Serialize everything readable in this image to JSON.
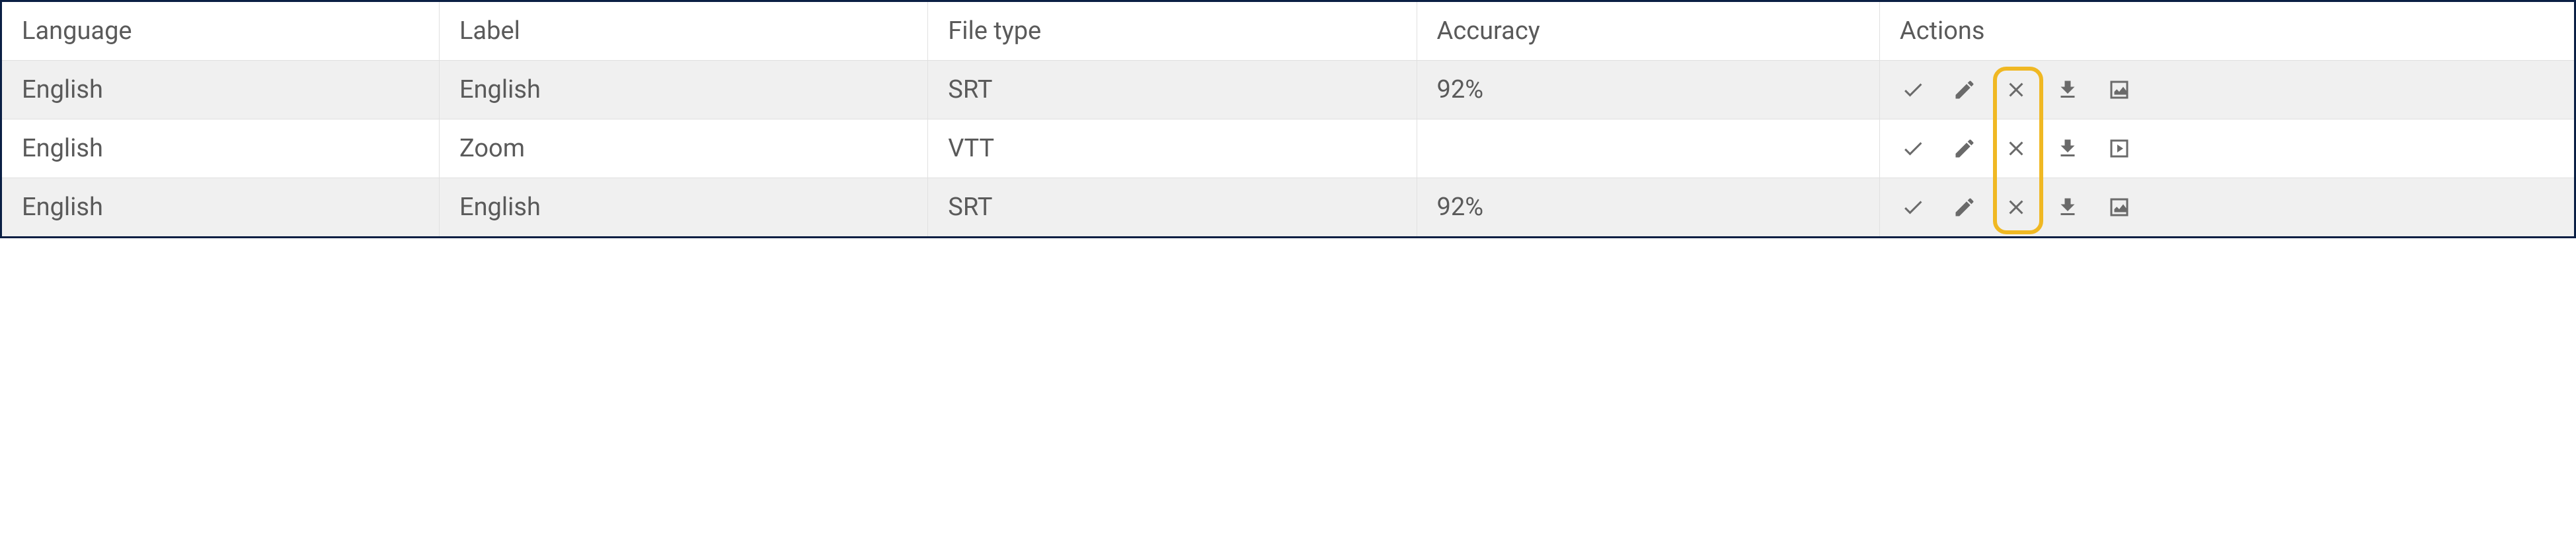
{
  "table": {
    "headers": {
      "language": "Language",
      "label": "Label",
      "filetype": "File type",
      "accuracy": "Accuracy",
      "actions": "Actions"
    },
    "rows": [
      {
        "language": "English",
        "label": "English",
        "filetype": "SRT",
        "accuracy": "92%",
        "striped": true,
        "lastIconType": "edit-view"
      },
      {
        "language": "English",
        "label": "Zoom",
        "filetype": "VTT",
        "accuracy": "",
        "striped": false,
        "lastIconType": "play-view"
      },
      {
        "language": "English",
        "label": "English",
        "filetype": "SRT",
        "accuracy": "92%",
        "striped": true,
        "lastIconType": "edit-view"
      }
    ]
  },
  "highlight": {
    "targetColumn": "delete"
  }
}
